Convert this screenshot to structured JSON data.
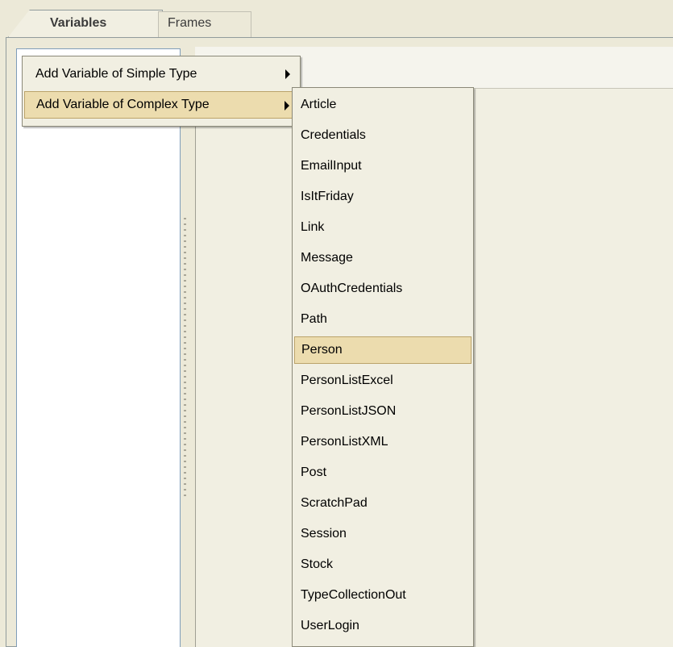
{
  "tabs": [
    {
      "label": "Variables",
      "active": true
    },
    {
      "label": "Frames",
      "active": false
    }
  ],
  "context_menu": {
    "items": [
      {
        "label": "Add Variable of Simple Type",
        "has_submenu": true
      },
      {
        "label": "Add Variable of Complex Type",
        "has_submenu": true,
        "selected": true
      }
    ]
  },
  "submenu": {
    "items": [
      "Article",
      "Credentials",
      "EmailInput",
      "IsItFriday",
      "Link",
      "Message",
      "OAuthCredentials",
      "Path",
      "Person",
      "PersonListExcel",
      "PersonListJSON",
      "PersonListXML",
      "Post",
      "ScratchPad",
      "Session",
      "Stock",
      "TypeCollectionOut",
      "UserLogin"
    ],
    "selected": "Person"
  },
  "colors": {
    "background": "#ece9d8",
    "menu_background": "#f1efe2",
    "highlight": "#ecdcae",
    "highlight_border": "#bba36a"
  }
}
